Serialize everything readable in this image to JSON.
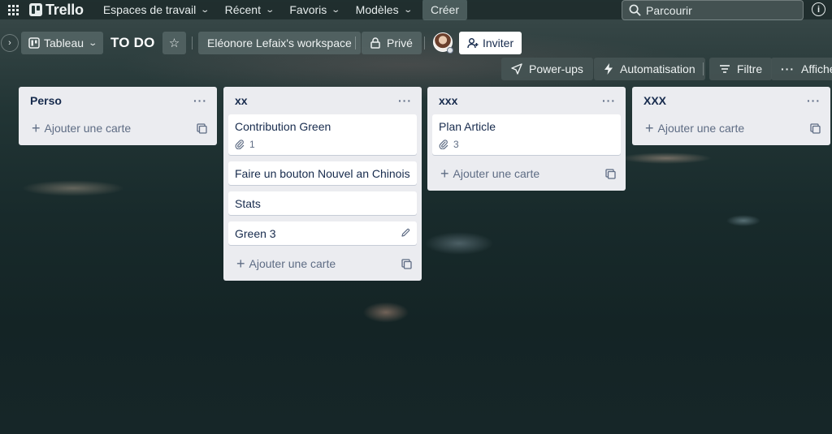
{
  "topnav": {
    "logo_text": "Trello",
    "items": [
      {
        "label": "Espaces de travail"
      },
      {
        "label": "Récent"
      },
      {
        "label": "Favoris"
      },
      {
        "label": "Modèles"
      }
    ],
    "create_label": "Créer",
    "search_placeholder": "Parcourir",
    "info_glyph": "i"
  },
  "board": {
    "view_label": "Tableau",
    "title": "TO DO",
    "workspace_label": "Eléonore Lefaix's workspace",
    "visibility_label": "Privé",
    "invite_label": "Inviter"
  },
  "toolbar": {
    "powerups_label": "Power-ups",
    "automation_label": "Automatisation",
    "filter_label": "Filtre",
    "show_label": "Afficher"
  },
  "lists": [
    {
      "title": "Perso",
      "cards": [],
      "add_label": "Ajouter une carte"
    },
    {
      "title": "xx",
      "cards": [
        {
          "title": "Contribution Green",
          "attachments": "1"
        },
        {
          "title": "Faire un bouton Nouvel an Chinois"
        },
        {
          "title": "Stats"
        },
        {
          "title": "Green 3"
        }
      ],
      "add_label": "Ajouter une carte"
    },
    {
      "title": "xxx",
      "cards": [
        {
          "title": "Plan Article",
          "attachments": "3"
        }
      ],
      "add_label": "Ajouter une carte"
    },
    {
      "title": "XXX",
      "cards": [],
      "add_label": "Ajouter une carte"
    }
  ],
  "colors": {
    "list_bg": "#ebecf0",
    "card_bg": "#ffffff",
    "text": "#172b4d",
    "muted": "#5e6c84"
  }
}
